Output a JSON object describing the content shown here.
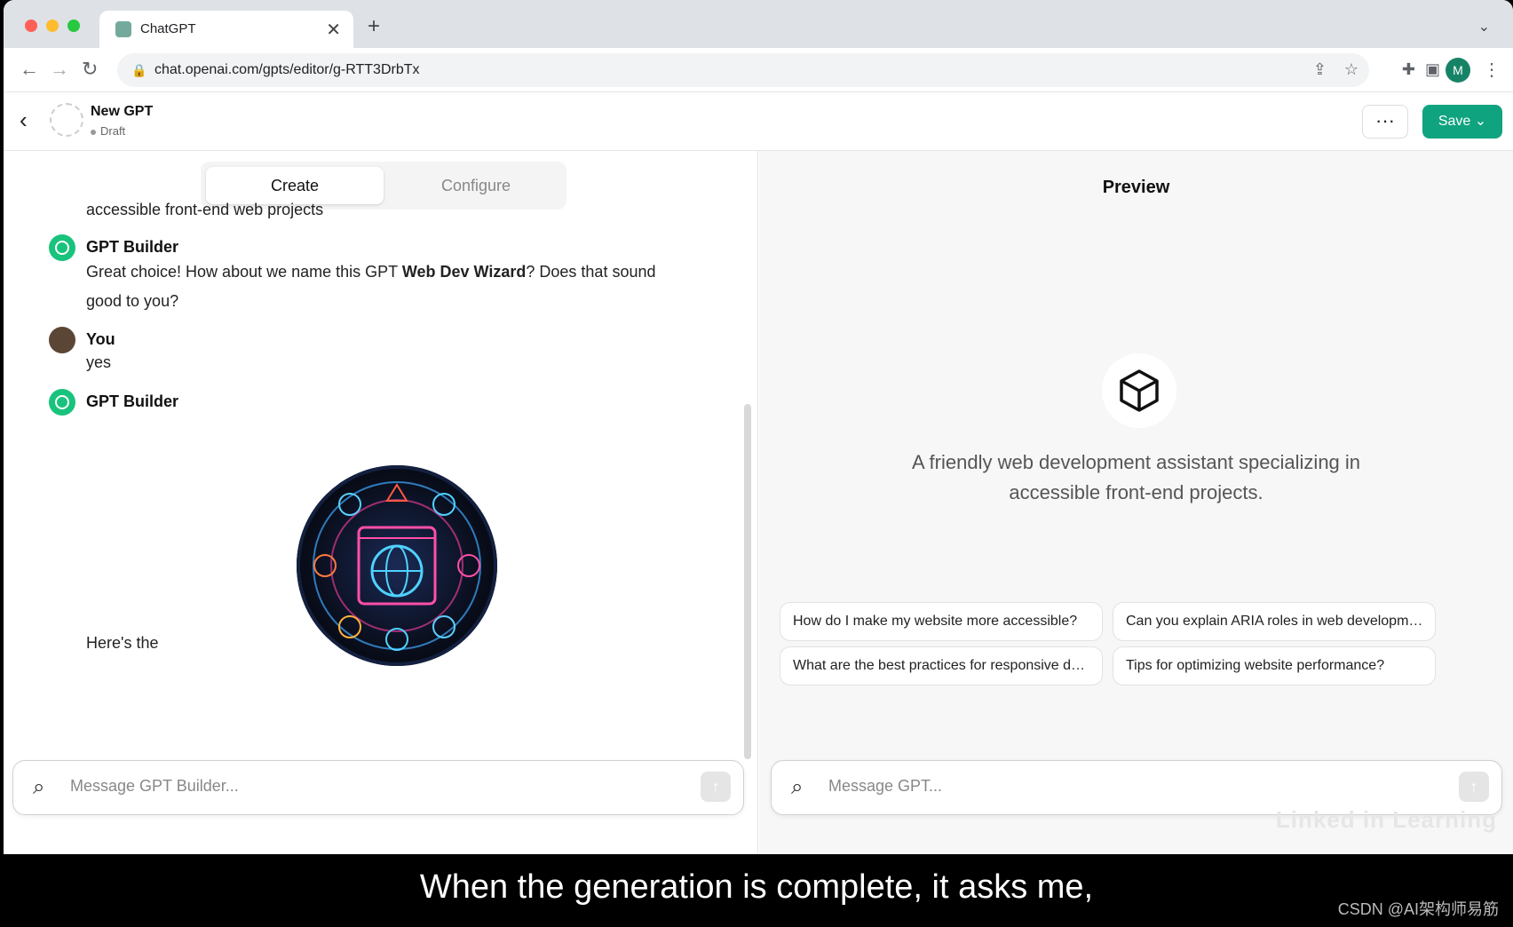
{
  "browser": {
    "tab_title": "ChatGPT",
    "tab_close": "✕",
    "new_tab": "+",
    "url": "chat.openai.com/gpts/editor/g-RTT3DrbTx",
    "profile_initial": "M"
  },
  "header": {
    "gpt_name": "New GPT",
    "gpt_status": "Draft",
    "more_label": "···",
    "save_label": "Save ⌄"
  },
  "left": {
    "tabs": {
      "create": "Create",
      "configure": "Configure"
    },
    "messages": [
      {
        "speaker": "",
        "text": "accessible front-end web projects"
      },
      {
        "speaker": "GPT Builder",
        "text_before": "Great choice! How about we name this GPT ",
        "text_bold": "Web Dev Wizard",
        "text_after": "? Does that sound good to you?"
      },
      {
        "speaker": "You",
        "text": "yes"
      },
      {
        "speaker": "GPT Builder",
        "text": "Here's the"
      }
    ],
    "composer_placeholder": "Message GPT Builder..."
  },
  "right": {
    "title": "Preview",
    "description": "A friendly web development assistant specializing in accessible front-end projects.",
    "suggestions": [
      "How do I make my website more accessible?",
      "Can you explain ARIA roles in web development?",
      "What are the best practices for responsive desig...",
      "Tips for optimizing website performance?"
    ],
    "composer_placeholder": "Message GPT...",
    "watermark": "Linked in Learning"
  },
  "caption": {
    "text": "When the generation is complete, it asks me,",
    "source": "CSDN @AI架构师易筋"
  },
  "colors": {
    "accent": "#10a37f",
    "builder_avatar": "#19c37d"
  }
}
